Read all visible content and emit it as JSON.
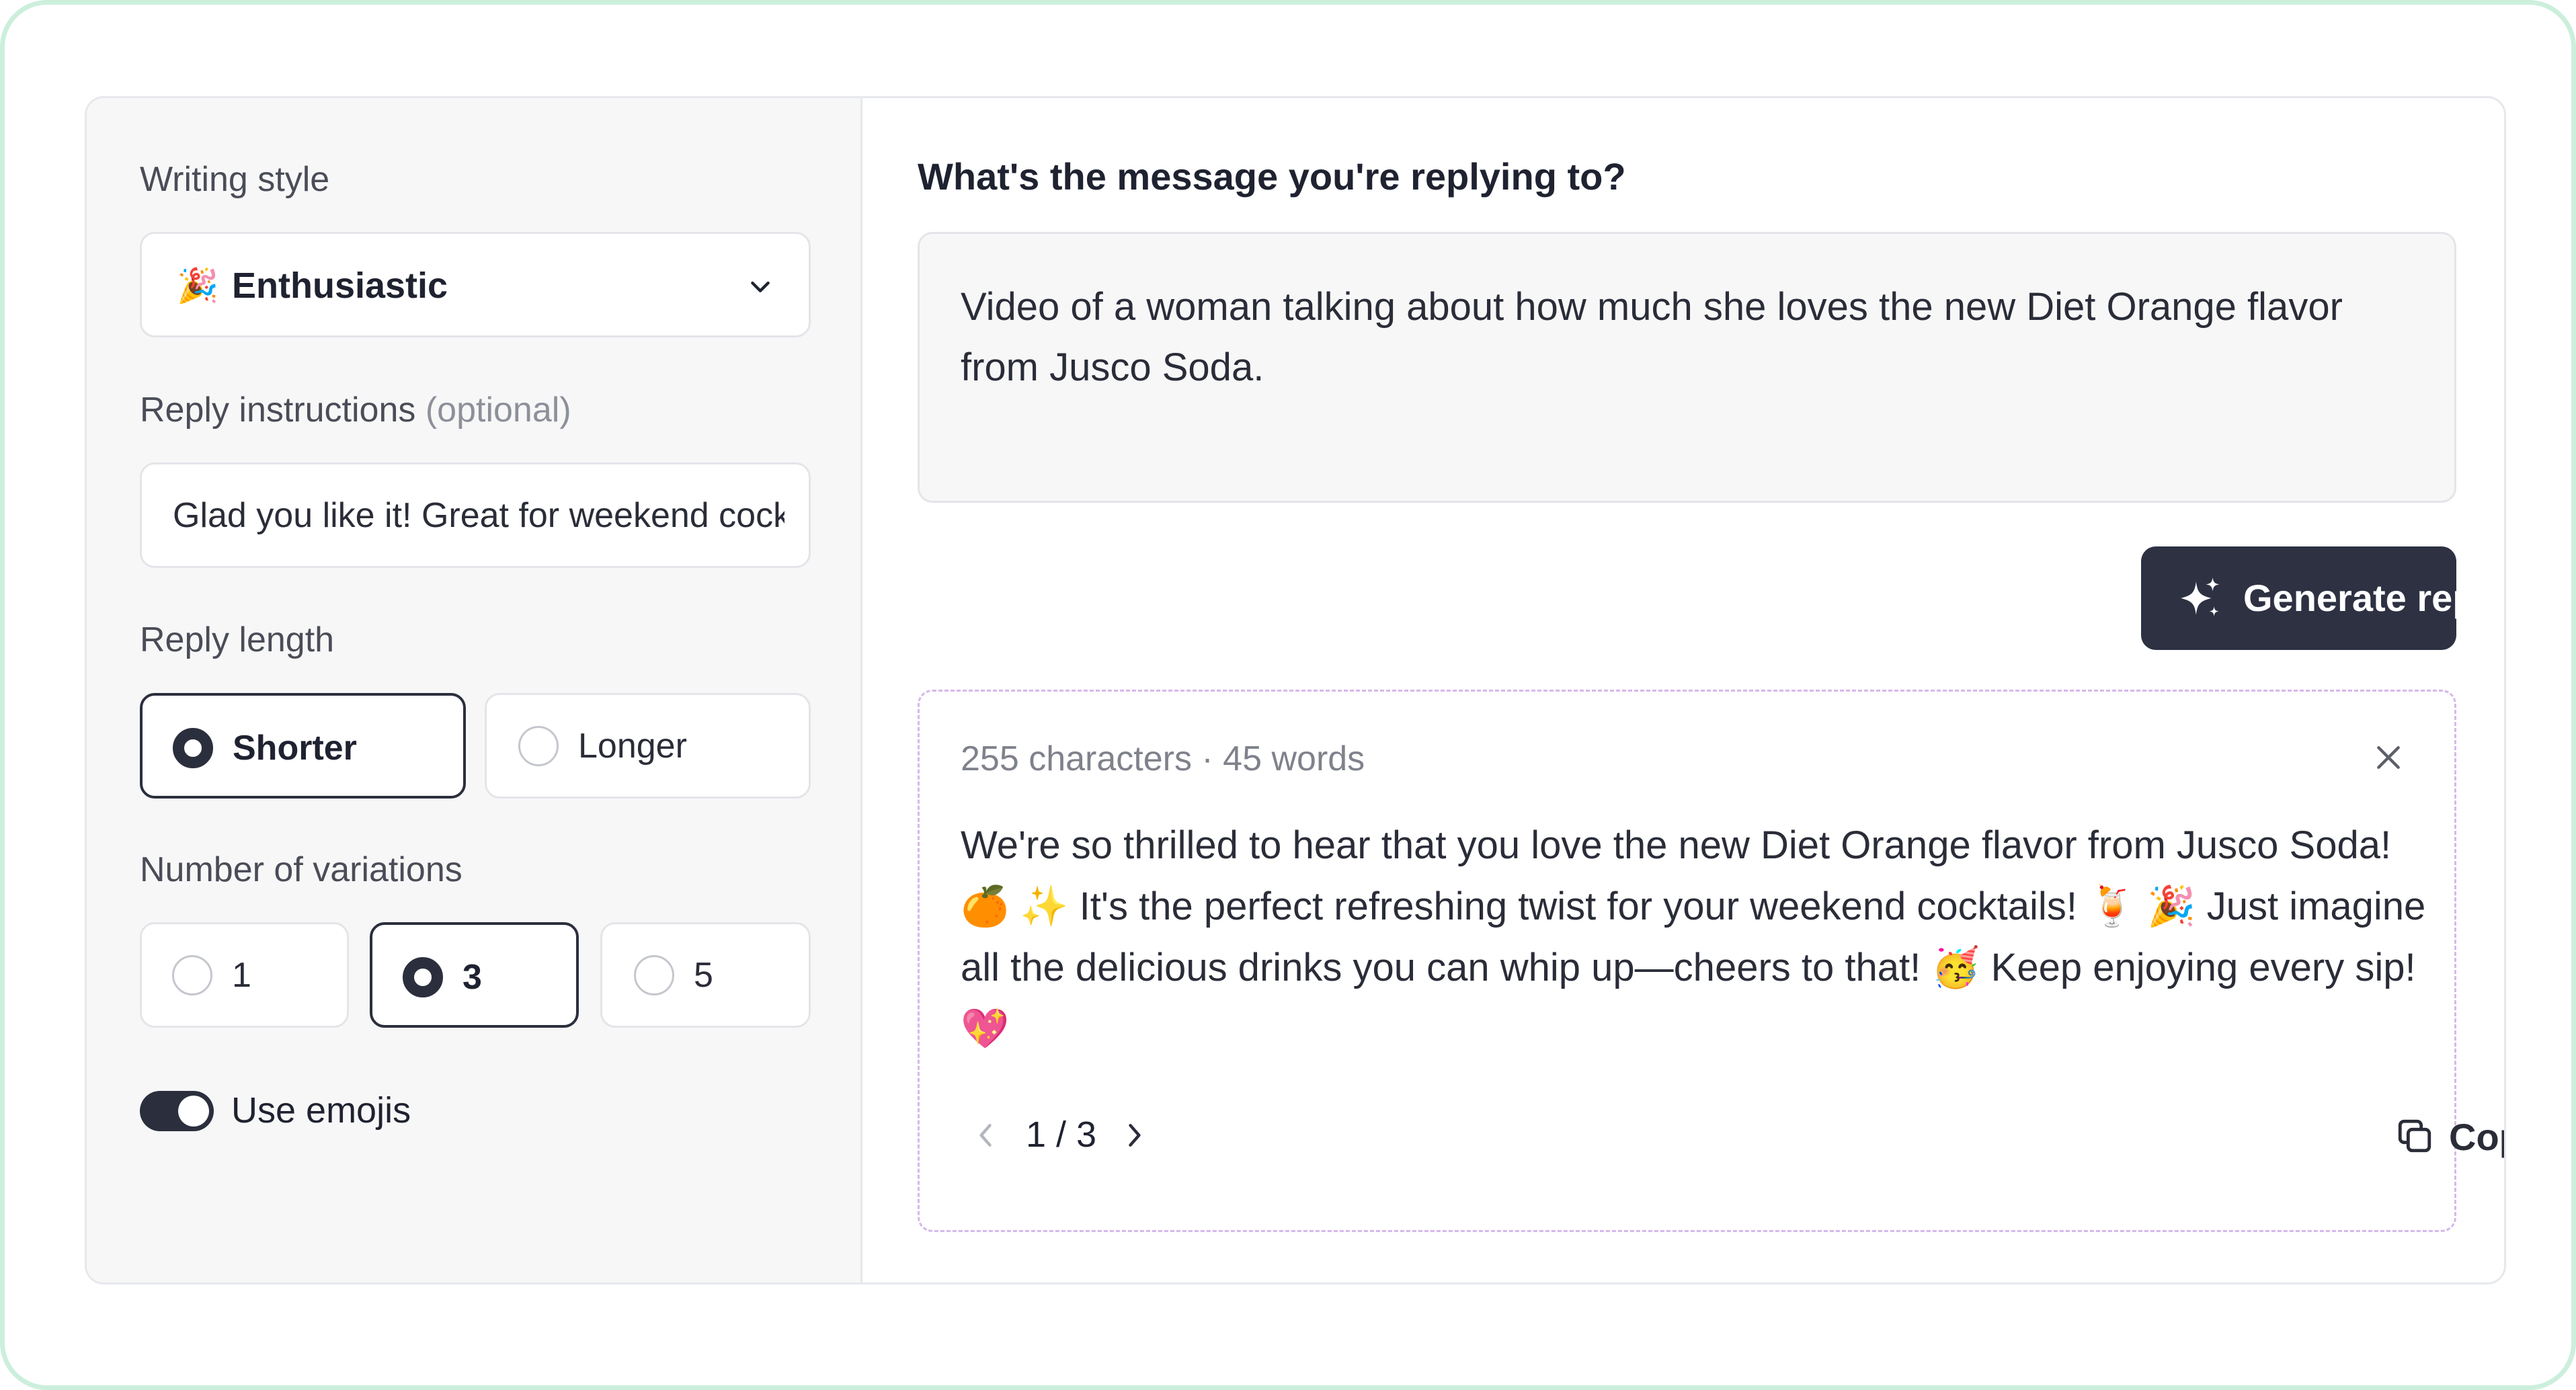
{
  "left_panel": {
    "writing_style": {
      "label": "Writing style",
      "selected_emoji": "🎉",
      "selected": "Enthusiastic",
      "icon": "chevron-down-icon"
    },
    "reply_instructions": {
      "label": "Reply instructions",
      "optional": "(optional)",
      "value": "Glad you like it! Great for weekend cocktails"
    },
    "reply_length": {
      "label": "Reply length",
      "options": [
        "Shorter",
        "Longer"
      ],
      "selected": "Shorter"
    },
    "variations": {
      "label": "Number of variations",
      "options": [
        "1",
        "3",
        "5"
      ],
      "selected": "3"
    },
    "emojis": {
      "label": "Use emojis",
      "enabled": true
    }
  },
  "right_panel": {
    "question": "What's the message you're replying to?",
    "message": "Video of a woman talking about how much she loves the new Diet Orange flavor from Jusco Soda.",
    "generate_button": "Generate reply",
    "generate_icon": "sparkles-icon",
    "result": {
      "stats": "255 characters · 45 words",
      "text": "We're so thrilled to hear that you love the new Diet Orange flavor from Jusco Soda! 🍊 ✨ It's the perfect refreshing twist for your weekend cocktails! 🍹 🎉 Just imagine all the delicious drinks you can whip up—cheers to that! 🥳 Keep enjoying every sip! 💖",
      "pager": "1 / 3",
      "copy_label": "Copy",
      "close_icon": "close-icon",
      "copy_icon": "copy-icon"
    }
  },
  "colors": {
    "primary": "#2d3142",
    "frame_border": "#ccefdc",
    "dashed_border": "#d6b8eb",
    "panel_bg": "#f7f7f8"
  }
}
